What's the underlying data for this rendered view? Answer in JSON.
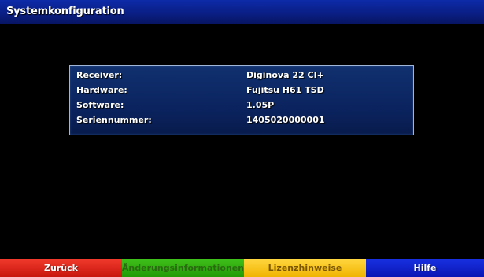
{
  "header": {
    "title": "Systemkonfiguration"
  },
  "info": {
    "rows": [
      {
        "label": "Receiver:",
        "value": "Diginova 22 CI+"
      },
      {
        "label": "Hardware:",
        "value": "Fujitsu H61 TSD"
      },
      {
        "label": "Software:",
        "value": "1.05P"
      },
      {
        "label": "Seriennummer:",
        "value": "1405020000001"
      }
    ]
  },
  "footer": {
    "red_label": "Zurück",
    "green_label": "Änderungsinformationen",
    "yellow_label": "Lizenzhinweise",
    "blue_label": "Hilfe"
  },
  "colors": {
    "title_bar": "#0a1f86",
    "panel": "#0b2460",
    "red": "#e0281c",
    "green": "#30ad10",
    "yellow": "#f8c620",
    "blue": "#1020cc"
  }
}
